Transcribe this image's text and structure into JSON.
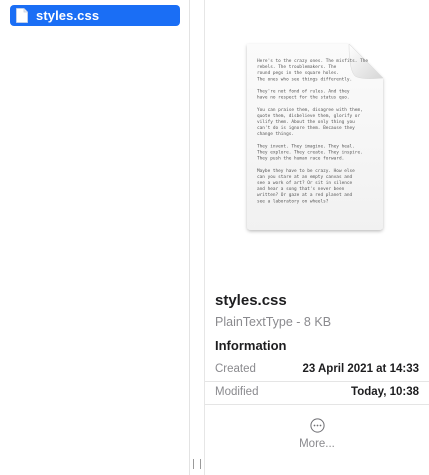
{
  "file_list": {
    "items": [
      {
        "name": "styles.css",
        "icon": "document-icon",
        "selected": true
      }
    ]
  },
  "preview": {
    "thumbnail_icon": "text-document-icon",
    "thumbnail_text": [
      "Here's to the crazy ones. The misfits. The",
      "rebels. The troublemakers. The",
      "round pegs in the square holes.",
      "The ones who see things differently.",
      "",
      "They're not fond of rules. And they",
      "have no respect for the status quo.",
      "",
      "You can praise them, disagree with them,",
      "quote them, disbelieve them, glorify or",
      "vilify them. About the only thing you",
      "can't do is ignore them. Because they",
      "change things.",
      "",
      "They invent. They imagine. They heal.",
      "They explore. They create. They inspire.",
      "They push the human race forward.",
      "",
      "Maybe they have to be crazy. How else",
      "can you stare at an empty canvas and",
      "see a work of art? Or sit in silence",
      "and hear a song that's never been",
      "written? Or gaze at a red planet and",
      "see a laboratory on wheels?"
    ],
    "title": "styles.css",
    "subtitle": "PlainTextType - 8 KB",
    "info_heading": "Information",
    "info": [
      {
        "label": "Created",
        "value": "23 April 2021 at 14:33"
      },
      {
        "label": "Modified",
        "value": "Today, 10:38"
      }
    ],
    "more_label": "More...",
    "more_icon": "ellipsis-circle-icon"
  },
  "colors": {
    "selection": "#1a6ef5",
    "secondary_text": "#8a8a8e",
    "primary_text": "#1d1d1f"
  }
}
